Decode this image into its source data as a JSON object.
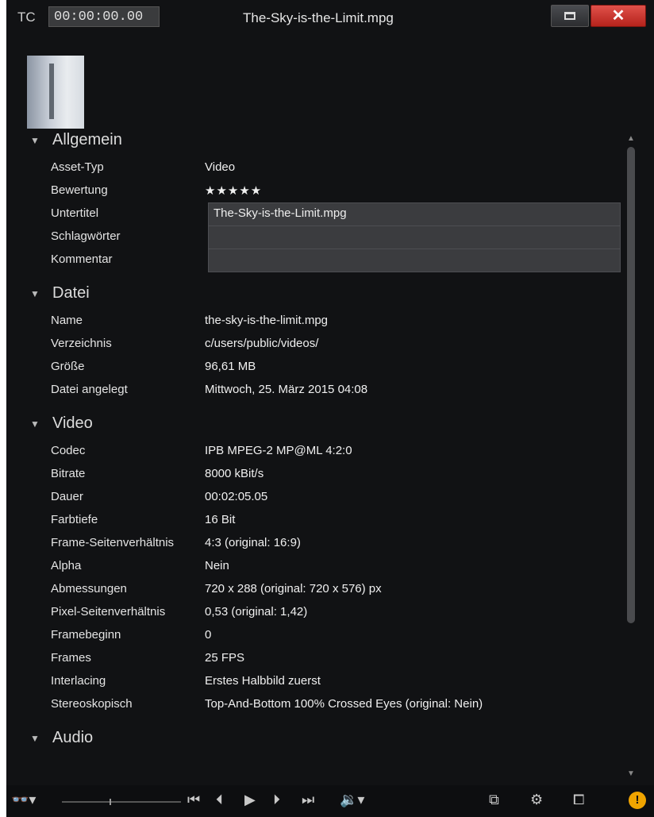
{
  "titlebar": {
    "tc_label": "TC",
    "timecode": "00:00:00.00",
    "title": "The-Sky-is-the-Limit.mpg",
    "close": "✕"
  },
  "sections": {
    "allgemein": {
      "label": "Allgemein",
      "rows": [
        {
          "k": "Asset-Typ",
          "v": "Video"
        },
        {
          "k": "Bewertung",
          "v": "★★★★★"
        },
        {
          "k": "Untertitel",
          "v": "The-Sky-is-the-Limit.mpg"
        },
        {
          "k": "Schlagwörter",
          "v": ""
        },
        {
          "k": "Kommentar",
          "v": ""
        }
      ]
    },
    "datei": {
      "label": "Datei",
      "rows": [
        {
          "k": "Name",
          "v": "the-sky-is-the-limit.mpg"
        },
        {
          "k": "Verzeichnis",
          "v": "c/users/public/videos/"
        },
        {
          "k": "Größe",
          "v": "96,61 MB"
        },
        {
          "k": "Datei angelegt",
          "v": "Mittwoch, 25. März 2015 04:08"
        }
      ]
    },
    "video": {
      "label": "Video",
      "rows": [
        {
          "k": "Codec",
          "v": "IPB MPEG-2 MP@ML 4:2:0"
        },
        {
          "k": "Bitrate",
          "v": "8000 kBit/s"
        },
        {
          "k": "Dauer",
          "v": "00:02:05.05"
        },
        {
          "k": "Farbtiefe",
          "v": "16 Bit"
        },
        {
          "k": "Frame-Seitenverhältnis",
          "v": "4:3 (original: 16:9)"
        },
        {
          "k": "Alpha",
          "v": "Nein"
        },
        {
          "k": "Abmessungen",
          "v": "720 x 288 (original: 720 x 576) px"
        },
        {
          "k": "Pixel-Seitenverhältnis",
          "v": "0,53 (original: 1,42)"
        },
        {
          "k": "Framebeginn",
          "v": "0"
        },
        {
          "k": "Frames",
          "v": "25 FPS"
        },
        {
          "k": "Interlacing",
          "v": "Erstes Halbbild zuerst"
        },
        {
          "k": "Stereoskopisch",
          "v": "Top-And-Bottom 100% Crossed Eyes (original: Nein)"
        }
      ]
    },
    "audio": {
      "label": "Audio"
    }
  },
  "toolbar": {
    "view_icon": "glasses-icon",
    "volume_icon": "speaker-icon",
    "info": "!"
  }
}
